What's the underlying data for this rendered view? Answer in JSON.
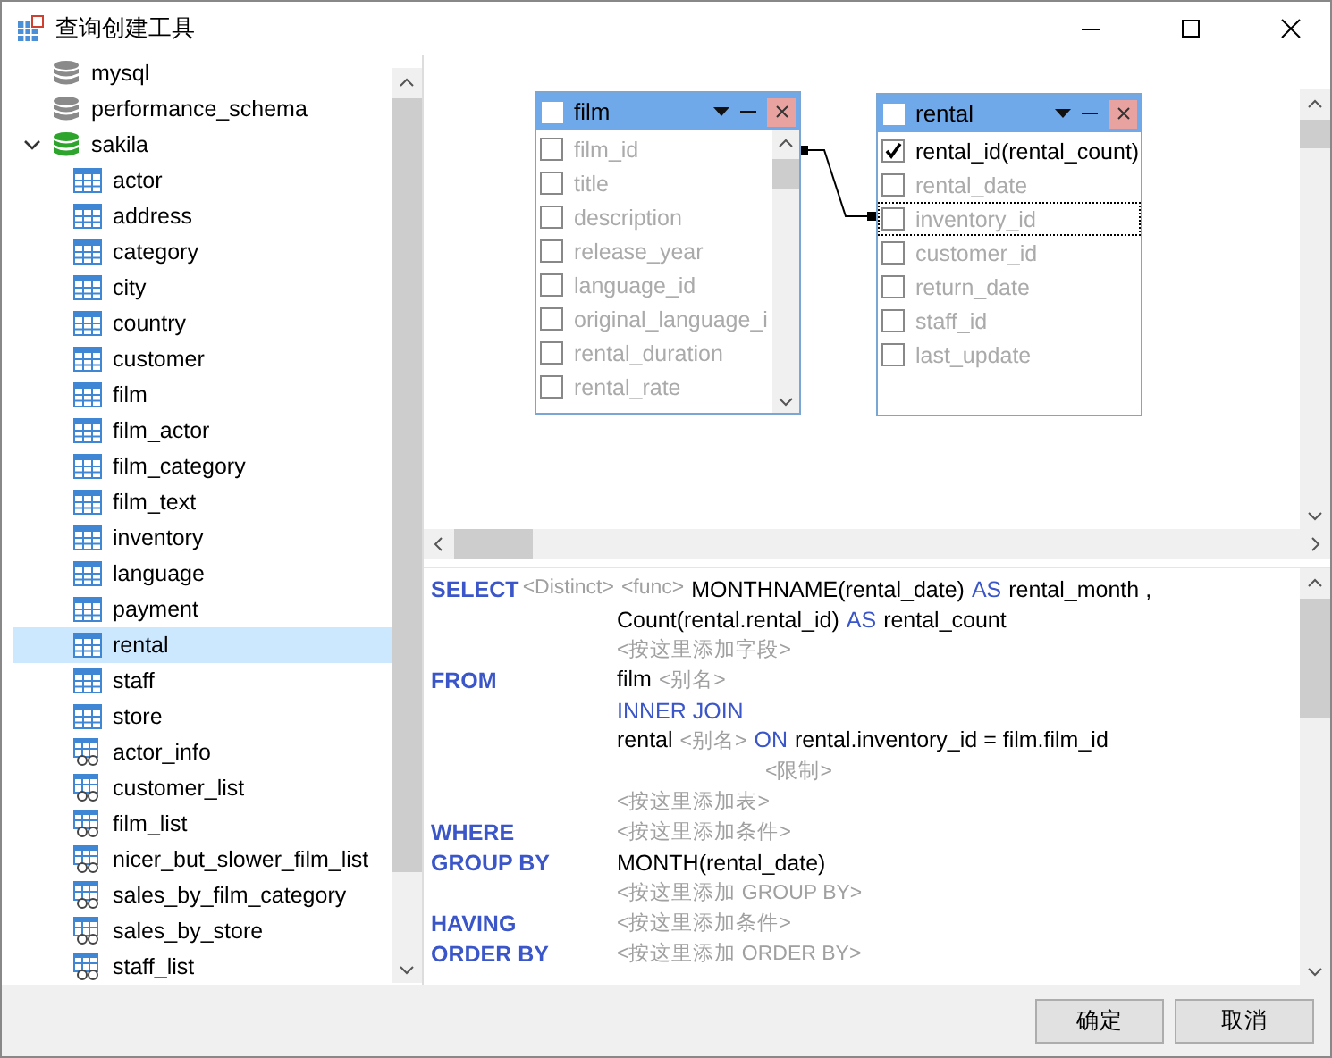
{
  "window": {
    "title": "查询创建工具"
  },
  "tree": [
    {
      "label": "mysql",
      "kind": "database",
      "connected": false,
      "selected": false
    },
    {
      "label": "performance_schema",
      "kind": "database",
      "connected": false,
      "selected": false
    },
    {
      "label": "sakila",
      "kind": "database",
      "connected": true,
      "expanded": true,
      "selected": false,
      "children": [
        {
          "label": "actor",
          "kind": "table",
          "selected": false
        },
        {
          "label": "address",
          "kind": "table",
          "selected": false
        },
        {
          "label": "category",
          "kind": "table",
          "selected": false
        },
        {
          "label": "city",
          "kind": "table",
          "selected": false
        },
        {
          "label": "country",
          "kind": "table",
          "selected": false
        },
        {
          "label": "customer",
          "kind": "table",
          "selected": false
        },
        {
          "label": "film",
          "kind": "table",
          "selected": false
        },
        {
          "label": "film_actor",
          "kind": "table",
          "selected": false
        },
        {
          "label": "film_category",
          "kind": "table",
          "selected": false
        },
        {
          "label": "film_text",
          "kind": "table",
          "selected": false
        },
        {
          "label": "inventory",
          "kind": "table",
          "selected": false
        },
        {
          "label": "language",
          "kind": "table",
          "selected": false
        },
        {
          "label": "payment",
          "kind": "table",
          "selected": false
        },
        {
          "label": "rental",
          "kind": "table",
          "selected": true
        },
        {
          "label": "staff",
          "kind": "table",
          "selected": false
        },
        {
          "label": "store",
          "kind": "table",
          "selected": false
        },
        {
          "label": "actor_info",
          "kind": "view",
          "selected": false
        },
        {
          "label": "customer_list",
          "kind": "view",
          "selected": false
        },
        {
          "label": "film_list",
          "kind": "view",
          "selected": false
        },
        {
          "label": "nicer_but_slower_film_list",
          "kind": "view",
          "selected": false
        },
        {
          "label": "sales_by_film_category",
          "kind": "view",
          "selected": false
        },
        {
          "label": "sales_by_store",
          "kind": "view",
          "selected": false
        },
        {
          "label": "staff_list",
          "kind": "view",
          "selected": false
        }
      ]
    }
  ],
  "diagram": {
    "tables": [
      {
        "title": "film",
        "checked": false,
        "scrollbar": true,
        "fields": [
          {
            "name": "film_id",
            "checked": false,
            "focused": false
          },
          {
            "name": "title",
            "checked": false,
            "focused": false
          },
          {
            "name": "description",
            "checked": false,
            "focused": false
          },
          {
            "name": "release_year",
            "checked": false,
            "focused": false
          },
          {
            "name": "language_id",
            "checked": false,
            "focused": false
          },
          {
            "name": "original_language_i",
            "checked": false,
            "focused": false
          },
          {
            "name": "rental_duration",
            "checked": false,
            "focused": false
          },
          {
            "name": "rental_rate",
            "checked": false,
            "focused": false
          }
        ]
      },
      {
        "title": "rental",
        "checked": false,
        "scrollbar": false,
        "fields": [
          {
            "name": "rental_id(rental_count)",
            "checked": true,
            "focused": false
          },
          {
            "name": "rental_date",
            "checked": false,
            "focused": false
          },
          {
            "name": "inventory_id",
            "checked": false,
            "focused": true
          },
          {
            "name": "customer_id",
            "checked": false,
            "focused": false
          },
          {
            "name": "return_date",
            "checked": false,
            "focused": false
          },
          {
            "name": "staff_id",
            "checked": false,
            "focused": false
          },
          {
            "name": "last_update",
            "checked": false,
            "focused": false
          }
        ]
      }
    ]
  },
  "sql": [
    {
      "clause": "SELECT",
      "inline": true,
      "tokens": [
        {
          "kind": "hint",
          "text": "<Distinct>"
        },
        {
          "kind": "hint",
          "text": "<func>"
        },
        {
          "kind": "text",
          "text": "MONTHNAME(rental_date)"
        },
        {
          "kind": "keyword",
          "text": "AS"
        },
        {
          "kind": "text",
          "text": "rental_month ,"
        }
      ]
    },
    {
      "tokens": [
        {
          "kind": "text",
          "text": "Count(rental.rental_id)"
        },
        {
          "kind": "keyword",
          "text": "AS"
        },
        {
          "kind": "text",
          "text": "rental_count"
        }
      ]
    },
    {
      "tokens": [
        {
          "kind": "hint",
          "text": "<按这里添加字段>"
        }
      ]
    },
    {
      "clause": "FROM",
      "tokens": [
        {
          "kind": "text",
          "text": "film"
        },
        {
          "kind": "hint",
          "text": "<别名>"
        }
      ]
    },
    {
      "tokens": [
        {
          "kind": "keyword",
          "text": "INNER JOIN"
        }
      ]
    },
    {
      "tokens": [
        {
          "kind": "text",
          "text": "rental"
        },
        {
          "kind": "hint",
          "text": "<别名>"
        },
        {
          "kind": "keyword",
          "text": "ON"
        },
        {
          "kind": "text",
          "text": "rental.inventory_id = film.film_id"
        }
      ]
    },
    {
      "nested": true,
      "tokens": [
        {
          "kind": "hint",
          "text": "<限制>"
        }
      ]
    },
    {
      "tokens": [
        {
          "kind": "hint",
          "text": "<按这里添加表>"
        }
      ]
    },
    {
      "clause": "WHERE",
      "tokens": [
        {
          "kind": "hint",
          "text": "<按这里添加条件>"
        }
      ]
    },
    {
      "clause": "GROUP BY",
      "tokens": [
        {
          "kind": "text",
          "text": "MONTH(rental_date)"
        }
      ]
    },
    {
      "tokens": [
        {
          "kind": "hint",
          "text": "<按这里添加 GROUP BY>"
        }
      ]
    },
    {
      "clause": "HAVING",
      "tokens": [
        {
          "kind": "hint",
          "text": "<按这里添加条件>"
        }
      ]
    },
    {
      "clause": "ORDER BY",
      "tokens": [
        {
          "kind": "hint",
          "text": "<按这里添加 ORDER BY>"
        }
      ]
    }
  ],
  "buttons": [
    {
      "label": "确定"
    },
    {
      "label": "取消"
    }
  ]
}
